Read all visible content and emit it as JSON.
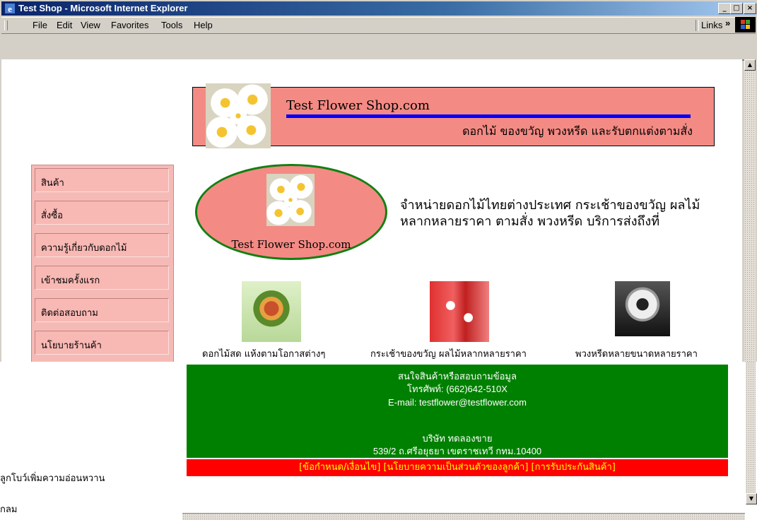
{
  "window": {
    "title": "Test Shop - Microsoft Internet Explorer"
  },
  "menu": {
    "items": [
      "File",
      "Edit",
      "View",
      "Favorites",
      "Tools",
      "Help"
    ],
    "links_label": "Links",
    "links_chevron": "»"
  },
  "window_controls": {
    "minimize": "_",
    "maximize": "□",
    "close": "×"
  },
  "scrollbar": {
    "up": "▲",
    "down": "▼"
  },
  "header": {
    "title": "Test  Flower Shop.com",
    "subtitle": "ดอกไม้ ของขวัญ พวงหรีด และรับตกแต่งตามสั่ง"
  },
  "nav": {
    "items": [
      {
        "label": "สินค้า"
      },
      {
        "label": "สั่งซื้อ"
      },
      {
        "label": "ความรู้เกี่ยวกับดอกไม้"
      },
      {
        "label": "เข้าชมครั้งแรก"
      },
      {
        "label": "ติดต่อสอบถาม"
      },
      {
        "label": "นโยบายร้านค้า"
      }
    ]
  },
  "logo": {
    "text": "Test Flower Shop.com"
  },
  "intro": {
    "text": "จำหน่ายดอกไม้ไทยต่างประเทศ กระเช้าของขวัญ ผลไม้ หลากหลายราคา ตามสั่ง พวงหรีด บริการส่งถึงที่"
  },
  "products": [
    {
      "caption": "ดอกไม้สด แห้งตามโอกาสต่างๆ"
    },
    {
      "caption": "กระเช้าของขวัญ ผลไม้หลากหลายราคา"
    },
    {
      "caption": "พวงหรีดหลายขนาดหลายราคา"
    }
  ],
  "contact": {
    "line1": "สนใจสินค้าหรือสอบถามข้อมูล",
    "line2": "โทรศัพท์: (662)642-510X",
    "line3": "E-mail: testflower@testflower.com",
    "line4": "บริษัท ทดลองขาย",
    "line5": "539/2 ถ.ศรีอยุธยา เขตราชเทวี กทม.10400"
  },
  "policy_bar": {
    "text": "[ข้อกำหนด/เงื่อนไข] [นโยบายความเป็นส่วนตัวของลูกค้า] [การรับประกันสินค้า]"
  },
  "background_window": {
    "line1": "ลูกโบว์เพิ่มความอ่อนหวาน",
    "line2": "กลม"
  },
  "colors": {
    "banner": "#f48a84",
    "nav": "#f8b8b4",
    "contact": "#008000",
    "policy": "#ff0000",
    "policy_text": "#ffff00",
    "title_bar": "#0a246a"
  }
}
